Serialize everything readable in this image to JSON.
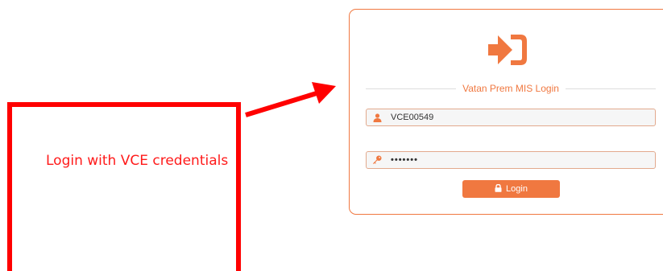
{
  "annotation": {
    "text": "Login with VCE credentials",
    "color": "#ff0000"
  },
  "login": {
    "title": "Vatan Prem MIS Login",
    "brand_color": "#f07840",
    "username_value": "VCE00549",
    "password_display": "•••••••",
    "button_label": "Login"
  },
  "icons": {
    "logo": "sign-in-icon",
    "username": "user-icon",
    "password": "key-icon",
    "button": "lock-icon"
  }
}
